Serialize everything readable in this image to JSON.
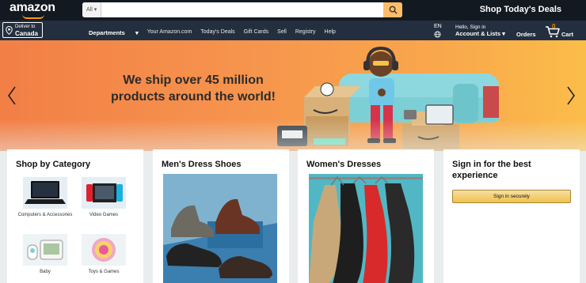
{
  "header": {
    "logo_text": "amazon",
    "search": {
      "department": "All",
      "placeholder": ""
    },
    "promo": "Shop Today's Deals"
  },
  "subnav": {
    "deliver_line1": "Deliver to",
    "deliver_line2": "Canada",
    "links": {
      "departments": "Departments",
      "your_amazon": "Your Amazon.com",
      "todays_deals": "Today's Deals",
      "gift_cards": "Gift Cards",
      "sell": "Sell",
      "registry": "Registry",
      "help": "Help"
    },
    "language": "EN",
    "account_line1": "Hello, Sign in",
    "account_line2": "Account & Lists",
    "orders": "Orders",
    "cart_count": "0",
    "cart_label": "Cart"
  },
  "hero": {
    "headline_line1": "We ship over 45 million",
    "headline_line2": "products around the world!"
  },
  "cards": {
    "category": {
      "title": "Shop by Category",
      "items": [
        {
          "label": "Computers & Accessories",
          "icon": "laptop-icon"
        },
        {
          "label": "Video Games",
          "icon": "game-console-icon"
        },
        {
          "label": "Baby",
          "icon": "baby-monitor-icon"
        },
        {
          "label": "Toys & Games",
          "icon": "toy-ball-icon"
        }
      ]
    },
    "shoes": {
      "title": "Men's Dress Shoes"
    },
    "dresses": {
      "title": "Women's Dresses"
    },
    "signin": {
      "title": "Sign in for the best experience",
      "button": "Sign in securely"
    }
  },
  "colors": {
    "nav_dark": "#131921",
    "nav_secondary": "#232f3e",
    "accent_orange": "#febd69",
    "hero_start": "#f27f46",
    "hero_end": "#fbbd49",
    "button_yellow": "#f0c14b"
  }
}
